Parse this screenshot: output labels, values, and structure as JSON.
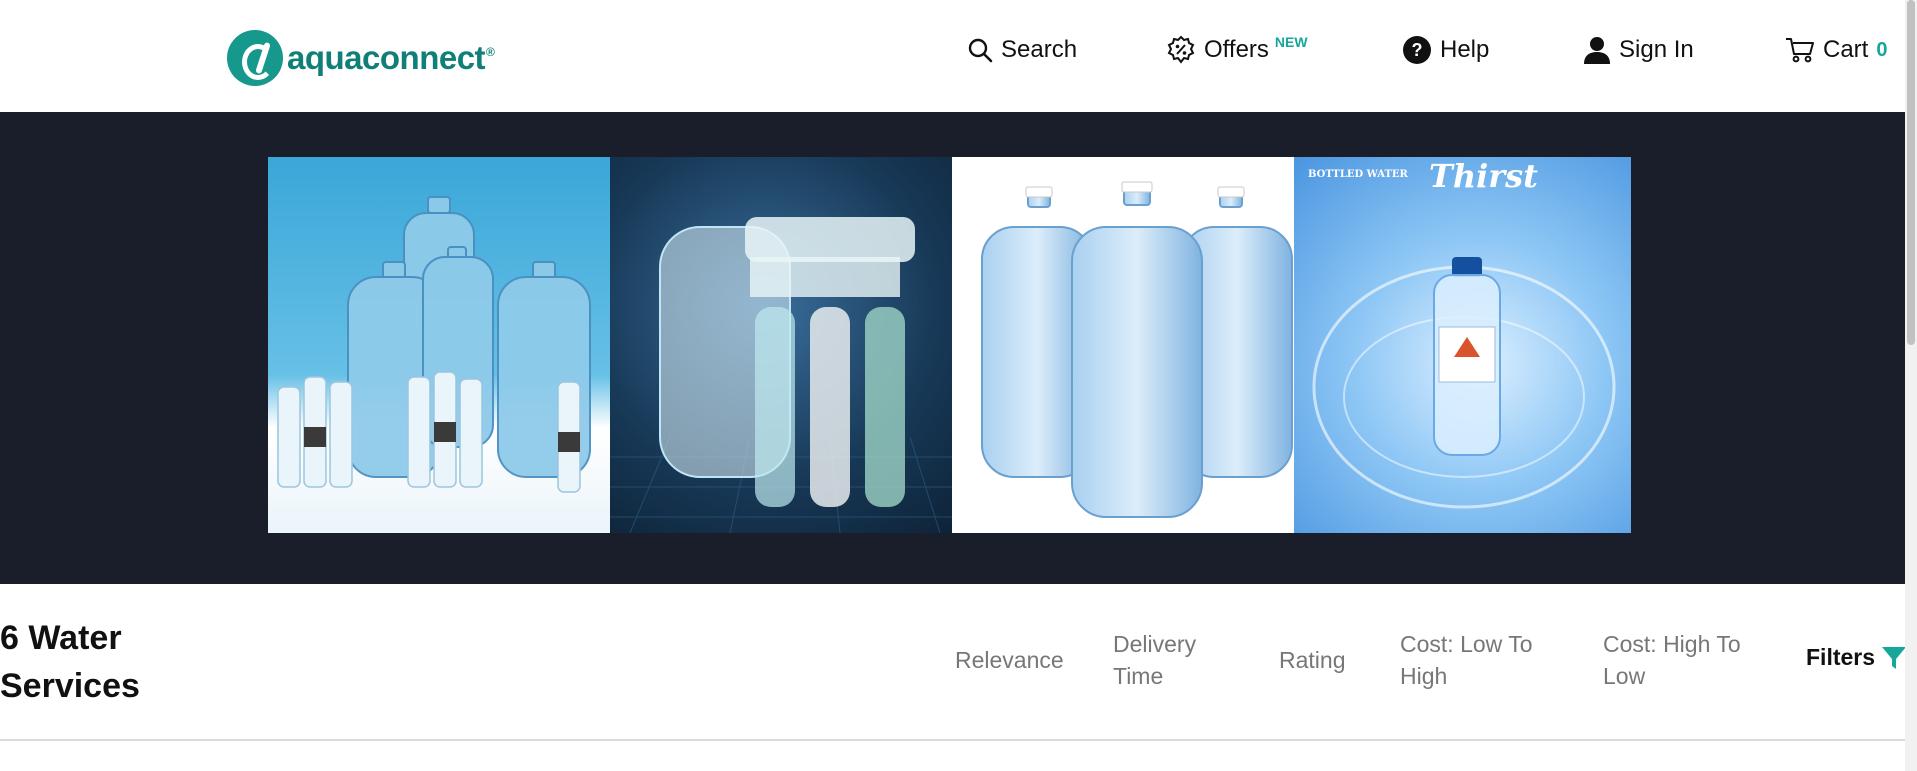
{
  "brand": {
    "name": "aquaconnect",
    "reg": "®",
    "color": "#17988c"
  },
  "nav": {
    "search": "Search",
    "offers": "Offers",
    "offers_badge": "NEW",
    "help": "Help",
    "sign_in": "Sign In",
    "cart": "Cart",
    "cart_count": "0"
  },
  "banner": {
    "slides": [
      {
        "name": "bottled-water-jugs"
      },
      {
        "name": "water-filter-system"
      },
      {
        "name": "water-cans"
      },
      {
        "name": "bottled-water-thirst",
        "caption": "BOTTLED WATER",
        "title": "Thirst"
      }
    ],
    "background": "#1a1e2b"
  },
  "results": {
    "title": "6 Water Services",
    "sort_options": [
      "Relevance",
      "Delivery Time",
      "Rating",
      "Cost: Low To High",
      "Cost: High To Low"
    ],
    "filters_label": "Filters"
  },
  "accent_color": "#17a79a"
}
